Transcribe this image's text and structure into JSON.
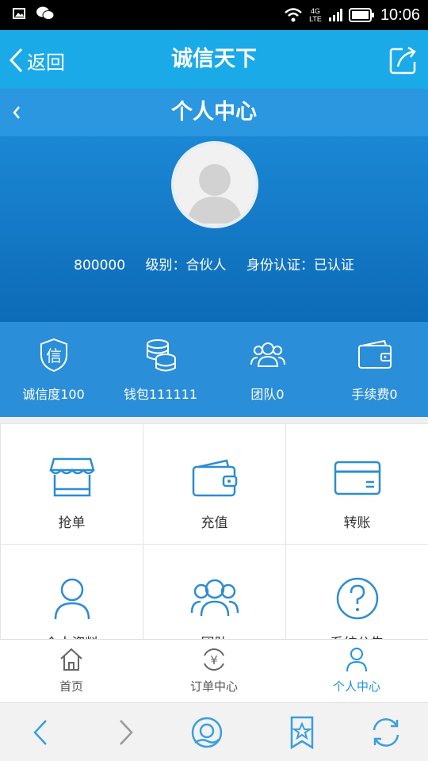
{
  "status_bar": {
    "time": "10:06",
    "network": "4G",
    "network_sub": "LTE",
    "icons": [
      "image-icon",
      "wechat-icon",
      "wifi-icon",
      "signal-icon",
      "battery-icon"
    ]
  },
  "navbar": {
    "back_label": "返回",
    "title": "诚信天下",
    "share_icon": "share-icon"
  },
  "profile": {
    "title": "个人中心",
    "account": "800000",
    "level": "级别：合伙人",
    "identity": "身份认证：已认证"
  },
  "stats": [
    {
      "icon": "credit-shield-icon",
      "label": "诚信度100"
    },
    {
      "icon": "coins-icon",
      "label": "钱包111111"
    },
    {
      "icon": "team-icon",
      "label": "团队0"
    },
    {
      "icon": "wallet-icon",
      "label": "手续费0"
    }
  ],
  "grid": [
    {
      "icon": "shop-icon",
      "label": "抢单"
    },
    {
      "icon": "wallet-icon",
      "label": "充值"
    },
    {
      "icon": "card-icon",
      "label": "转账"
    },
    {
      "icon": "person-icon",
      "label": "个人资料"
    },
    {
      "icon": "group-icon",
      "label": "团队"
    },
    {
      "icon": "question-icon",
      "label": "系统公告"
    }
  ],
  "tabs": [
    {
      "icon": "home-icon",
      "label": "首页"
    },
    {
      "icon": "order-icon",
      "label": "订单中心"
    },
    {
      "icon": "user-icon",
      "label": "个人中心",
      "active": true
    }
  ],
  "browser": {
    "buttons": [
      "back-icon",
      "forward-icon",
      "home-icon",
      "bookmark-icon",
      "refresh-icon"
    ]
  },
  "colors": {
    "nav": "#1baae8",
    "accent": "#1c93e0",
    "icon_blue": "#2d8cd2"
  }
}
